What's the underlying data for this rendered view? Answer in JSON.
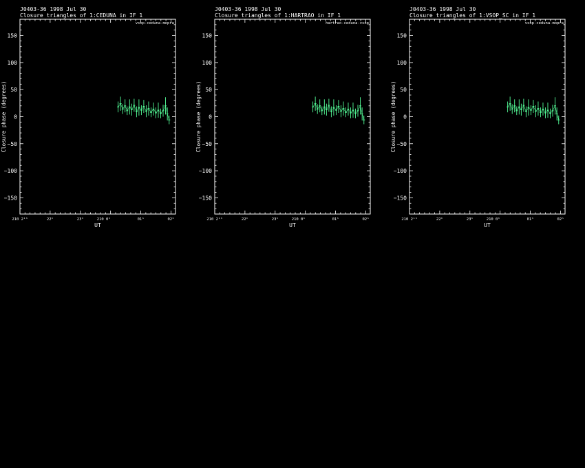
{
  "colors": {
    "background": "#000000",
    "foreground": "#ffffff",
    "data": "#55ff99"
  },
  "chart_data": [
    {
      "type": "scatter",
      "title": "J0403-36  1998 Jul 30",
      "subtitle": "Closure triangles of 1:CEDUNA in IF 1",
      "baseline_label": "vsop-ceduna-mopra",
      "xlabel": "UT",
      "ylabel": "Closure phase  (degrees)",
      "ylim": [
        -180,
        180
      ],
      "xlim": [
        21.0,
        26.15
      ],
      "y_ticks": [
        -150,
        -100,
        -50,
        0,
        50,
        100,
        150
      ],
      "x_ticks": [
        {
          "value": 21.0,
          "label": "210 2¹ʰ"
        },
        {
          "value": 22.0,
          "label": "22ʰ"
        },
        {
          "value": 23.0,
          "label": "23ʰ"
        },
        {
          "value": 24.0,
          "label": "210 0ʰ"
        },
        {
          "value": 25.0,
          "label": "01ʰ"
        },
        {
          "value": 26.0,
          "label": "02ʰ"
        }
      ],
      "x_units": "hours UT",
      "points": [
        {
          "x": 24.25,
          "y": 18,
          "err": 10
        },
        {
          "x": 24.33,
          "y": 24,
          "err": 13
        },
        {
          "x": 24.4,
          "y": 14,
          "err": 9
        },
        {
          "x": 24.48,
          "y": 20,
          "err": 12
        },
        {
          "x": 24.55,
          "y": 11,
          "err": 8
        },
        {
          "x": 24.63,
          "y": 18,
          "err": 14
        },
        {
          "x": 24.7,
          "y": 13,
          "err": 11
        },
        {
          "x": 24.78,
          "y": 21,
          "err": 12
        },
        {
          "x": 24.86,
          "y": 9,
          "err": 10
        },
        {
          "x": 24.94,
          "y": 17,
          "err": 15
        },
        {
          "x": 25.02,
          "y": 12,
          "err": 9
        },
        {
          "x": 25.1,
          "y": 19,
          "err": 12
        },
        {
          "x": 25.18,
          "y": 10,
          "err": 11
        },
        {
          "x": 25.26,
          "y": 15,
          "err": 13
        },
        {
          "x": 25.34,
          "y": 8,
          "err": 9
        },
        {
          "x": 25.42,
          "y": 14,
          "err": 12
        },
        {
          "x": 25.5,
          "y": 7,
          "err": 10
        },
        {
          "x": 25.58,
          "y": 12,
          "err": 14
        },
        {
          "x": 25.66,
          "y": 6,
          "err": 9
        },
        {
          "x": 25.74,
          "y": 11,
          "err": 11
        },
        {
          "x": 25.82,
          "y": 20,
          "err": 16
        },
        {
          "x": 25.88,
          "y": 5,
          "err": 12
        },
        {
          "x": 25.94,
          "y": -6,
          "err": 8
        }
      ]
    },
    {
      "type": "scatter",
      "title": "J0403-36  1998 Jul 30",
      "subtitle": "Closure triangles of 1:HARTRAO in IF 1",
      "baseline_label": "hartrao-ceduna-vsop",
      "xlabel": "UT",
      "ylabel": "Closure phase  (degrees)",
      "ylim": [
        -180,
        180
      ],
      "xlim": [
        21.0,
        26.15
      ],
      "y_ticks": [
        -150,
        -100,
        -50,
        0,
        50,
        100,
        150
      ],
      "x_ticks": [
        {
          "value": 21.0,
          "label": "210 2¹ʰ"
        },
        {
          "value": 22.0,
          "label": "22ʰ"
        },
        {
          "value": 23.0,
          "label": "23ʰ"
        },
        {
          "value": 24.0,
          "label": "210 0ʰ"
        },
        {
          "value": 25.0,
          "label": "01ʰ"
        },
        {
          "value": 26.0,
          "label": "02ʰ"
        }
      ],
      "x_units": "hours UT",
      "points": [
        {
          "x": 24.25,
          "y": 18,
          "err": 10
        },
        {
          "x": 24.33,
          "y": 24,
          "err": 13
        },
        {
          "x": 24.4,
          "y": 14,
          "err": 9
        },
        {
          "x": 24.48,
          "y": 20,
          "err": 12
        },
        {
          "x": 24.55,
          "y": 11,
          "err": 8
        },
        {
          "x": 24.63,
          "y": 18,
          "err": 14
        },
        {
          "x": 24.7,
          "y": 13,
          "err": 11
        },
        {
          "x": 24.78,
          "y": 21,
          "err": 12
        },
        {
          "x": 24.86,
          "y": 9,
          "err": 10
        },
        {
          "x": 24.94,
          "y": 17,
          "err": 15
        },
        {
          "x": 25.02,
          "y": 12,
          "err": 9
        },
        {
          "x": 25.1,
          "y": 19,
          "err": 12
        },
        {
          "x": 25.18,
          "y": 10,
          "err": 11
        },
        {
          "x": 25.26,
          "y": 15,
          "err": 13
        },
        {
          "x": 25.34,
          "y": 8,
          "err": 9
        },
        {
          "x": 25.42,
          "y": 14,
          "err": 12
        },
        {
          "x": 25.5,
          "y": 7,
          "err": 10
        },
        {
          "x": 25.58,
          "y": 12,
          "err": 14
        },
        {
          "x": 25.66,
          "y": 6,
          "err": 9
        },
        {
          "x": 25.74,
          "y": 11,
          "err": 11
        },
        {
          "x": 25.82,
          "y": 20,
          "err": 16
        },
        {
          "x": 25.88,
          "y": 5,
          "err": 12
        },
        {
          "x": 25.94,
          "y": -6,
          "err": 8
        }
      ]
    },
    {
      "type": "scatter",
      "title": "J0403-36  1998 Jul 30",
      "subtitle": "Closure triangles of 1:VSOP_SC in IF 1",
      "baseline_label": "vsop-ceduna-mopra",
      "xlabel": "UT",
      "ylabel": "Closure phase  (degrees)",
      "ylim": [
        -180,
        180
      ],
      "xlim": [
        21.0,
        26.15
      ],
      "y_ticks": [
        -150,
        -100,
        -50,
        0,
        50,
        100,
        150
      ],
      "x_ticks": [
        {
          "value": 21.0,
          "label": "210 2¹ʰ"
        },
        {
          "value": 22.0,
          "label": "22ʰ"
        },
        {
          "value": 23.0,
          "label": "23ʰ"
        },
        {
          "value": 24.0,
          "label": "210 0ʰ"
        },
        {
          "value": 25.0,
          "label": "01ʰ"
        },
        {
          "value": 26.0,
          "label": "02ʰ"
        }
      ],
      "x_units": "hours UT",
      "points": [
        {
          "x": 24.25,
          "y": 18,
          "err": 10
        },
        {
          "x": 24.33,
          "y": 24,
          "err": 13
        },
        {
          "x": 24.4,
          "y": 14,
          "err": 9
        },
        {
          "x": 24.48,
          "y": 20,
          "err": 12
        },
        {
          "x": 24.55,
          "y": 11,
          "err": 8
        },
        {
          "x": 24.63,
          "y": 18,
          "err": 14
        },
        {
          "x": 24.7,
          "y": 13,
          "err": 11
        },
        {
          "x": 24.78,
          "y": 21,
          "err": 12
        },
        {
          "x": 24.86,
          "y": 9,
          "err": 10
        },
        {
          "x": 24.94,
          "y": 17,
          "err": 15
        },
        {
          "x": 25.02,
          "y": 12,
          "err": 9
        },
        {
          "x": 25.1,
          "y": 19,
          "err": 12
        },
        {
          "x": 25.18,
          "y": 10,
          "err": 11
        },
        {
          "x": 25.26,
          "y": 15,
          "err": 13
        },
        {
          "x": 25.34,
          "y": 8,
          "err": 9
        },
        {
          "x": 25.42,
          "y": 14,
          "err": 12
        },
        {
          "x": 25.5,
          "y": 7,
          "err": 10
        },
        {
          "x": 25.58,
          "y": 12,
          "err": 14
        },
        {
          "x": 25.66,
          "y": 6,
          "err": 9
        },
        {
          "x": 25.74,
          "y": 11,
          "err": 11
        },
        {
          "x": 25.82,
          "y": 20,
          "err": 16
        },
        {
          "x": 25.88,
          "y": 5,
          "err": 12
        },
        {
          "x": 25.94,
          "y": -6,
          "err": 8
        }
      ]
    }
  ]
}
